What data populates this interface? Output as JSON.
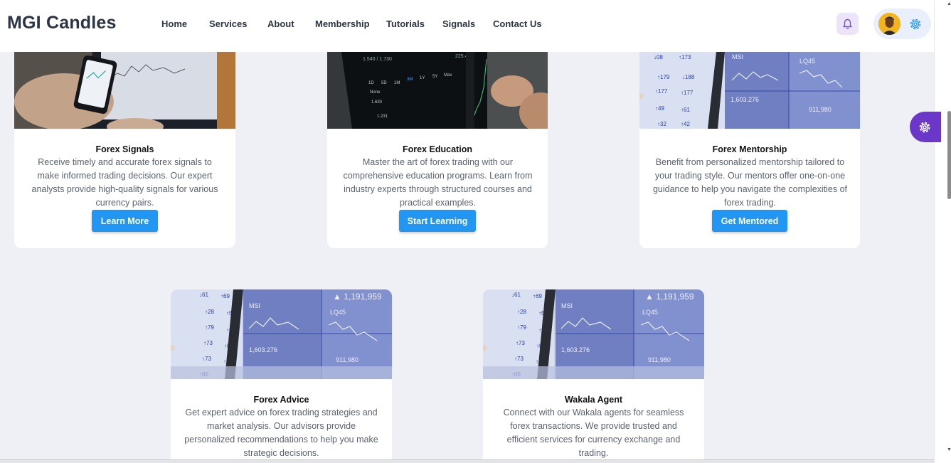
{
  "header": {
    "brand": "MGI Candles",
    "nav": [
      "Home",
      "Services",
      "About",
      "Membership",
      "Tutorials",
      "Signals",
      "Contact Us"
    ]
  },
  "icons": {
    "notifications": "bell-icon",
    "account_settings": "gear-icon",
    "theme_settings": "gear-icon",
    "profile": "avatar"
  },
  "colors": {
    "button": "#2196f3",
    "fab": "#6a37c8",
    "bell_bg": "#ece4fb",
    "page_bg": "#eef0f6"
  },
  "cards": [
    {
      "title": "Forex Signals",
      "text": "Receive timely and accurate forex signals to make informed trading decisions. Our expert analysts provide high-quality signals for various currency pairs.",
      "button": "Learn More"
    },
    {
      "title": "Forex Education",
      "text": "Master the art of forex trading with our comprehensive education programs. Learn from industry experts through structured courses and practical examples.",
      "button": "Start Learning"
    },
    {
      "title": "Forex Mentorship",
      "text": "Benefit from personalized mentorship tailored to your trading style. Our mentors offer one-on-one guidance to help you navigate the complexities of forex trading.",
      "button": "Get Mentored"
    },
    {
      "title": "Forex Advice",
      "text": "Get expert advice on forex trading strategies and market analysis. Our advisors provide personalized recommendations to help you make strategic decisions."
    },
    {
      "title": "Wakala Agent",
      "text": "Connect with our Wakala agents for seamless forex transactions. We provide trusted and efficient services for currency exchange and trading."
    }
  ]
}
